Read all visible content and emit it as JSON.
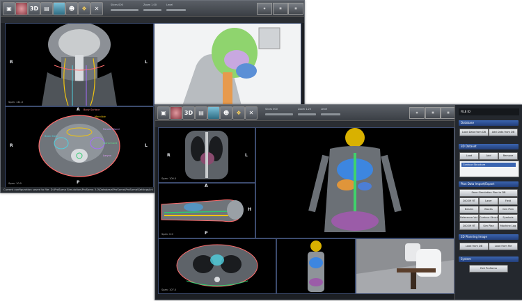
{
  "window1": {
    "toolbar": {
      "three_d_label": "3D",
      "slices_text": "Slices 000",
      "zoom_text": "Zoom 1.00",
      "level_text": "Level"
    },
    "views": {
      "coronal": {
        "top": "P",
        "left": "R",
        "right": "L",
        "caption": "Span: 141.0"
      },
      "axial": {
        "top": "A",
        "left": "R",
        "right": "L",
        "bottom": "P",
        "caption": "Span: 10.0"
      }
    },
    "labels": [
      "Body Surface",
      "Mandible",
      "Parotid Gland",
      "Spinal Cord",
      "Brain Stem",
      "Larynx"
    ],
    "status": "Current configuration saved to file: D:\\ProSoma Simulation\\ProSoma 3.0\\Database\\ProSoma\\ProSoma\\Settings\\ini"
  },
  "window2": {
    "toolbar": {
      "three_d_label": "3D",
      "slices_text": "Slices 000",
      "zoom_text": "Zoom 1.23",
      "level_text": "Level"
    },
    "views": {
      "coronal": {
        "left": "R",
        "right": "L",
        "caption": "Span: 100.0"
      },
      "sagittal": {
        "top": "A",
        "right": "H",
        "bottom": "P",
        "caption": "Span: 0.0"
      },
      "axial": {
        "caption": "Span: 107.0"
      }
    },
    "panel": {
      "file_label": "FILE IO",
      "database": {
        "header": "Database",
        "load_button": "Load Data from DB",
        "add_button": "Add Data from DB"
      },
      "dataset": {
        "header": "3D Dataset",
        "buttons": [
          "Load",
          "Add",
          "Remove"
        ],
        "item": "Contour Structure"
      },
      "plan_io": {
        "header": "Plan Data Import/Export",
        "save_button": "Save Simulation Plan to DB",
        "buttons": [
          "DICOM RT",
          "Laser",
          "Field",
          "Beams",
          "Blocks",
          "Gen Plan",
          "Reference Vol.",
          "Contour Struct.",
          "Symbols",
          "DICOM RT",
          "Sim Plan",
          "Machine Log"
        ]
      },
      "planning_image": {
        "header": "2D Planning Image",
        "buttons": [
          "Load from DB",
          "Load from file"
        ]
      },
      "system": {
        "header": "System",
        "exit_button": "Exit ProSoma"
      }
    }
  },
  "colors": {
    "window_bg": "#1c1f24",
    "view_border": "#3c4b6e",
    "section_header": "#3a64b0",
    "button_face": "#d8dce0"
  }
}
